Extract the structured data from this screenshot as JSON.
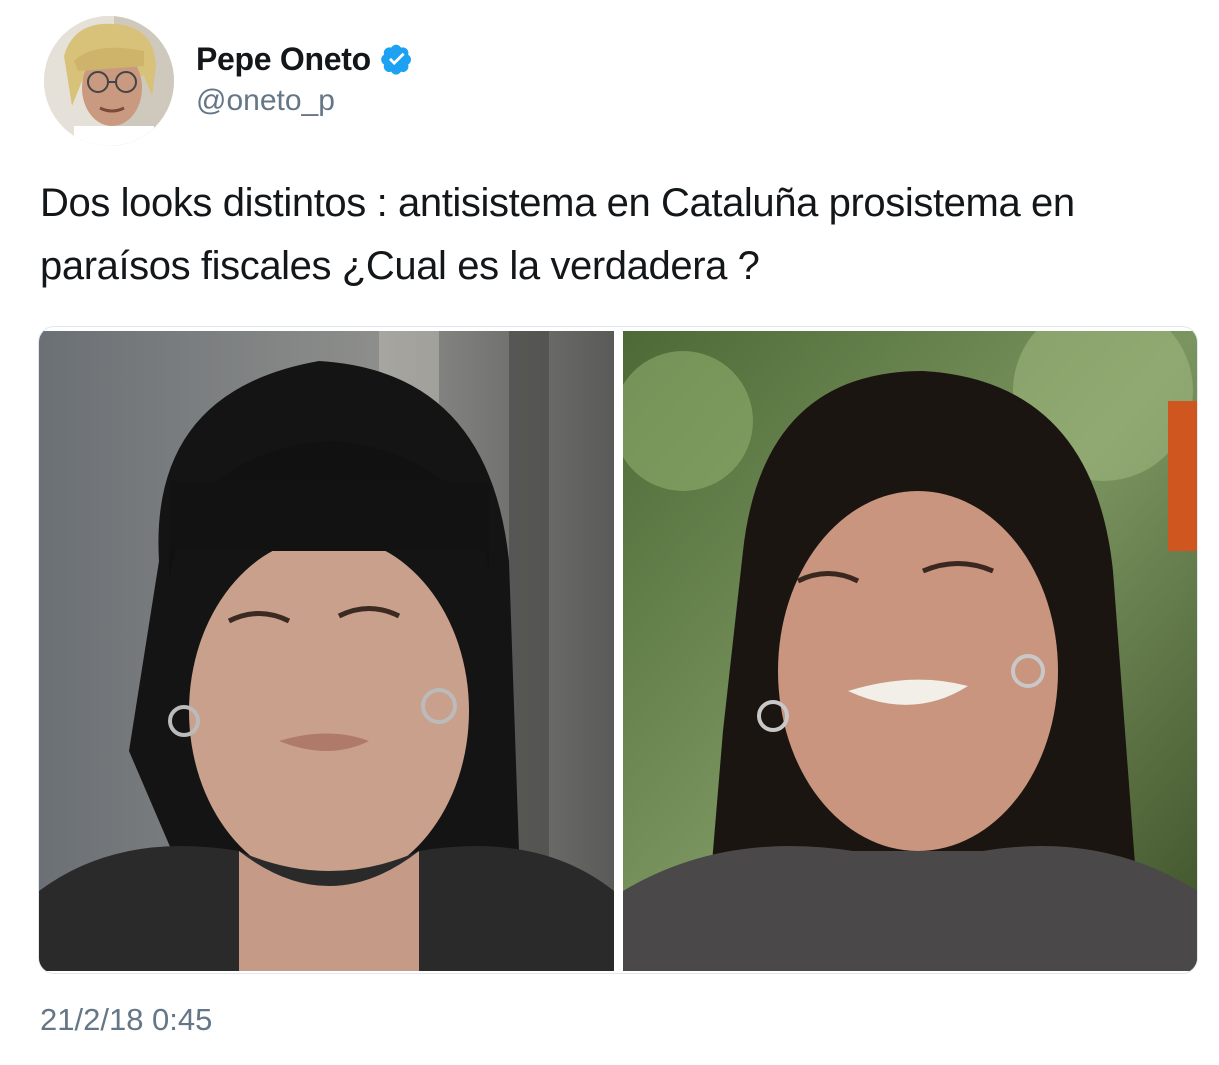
{
  "tweet": {
    "author": {
      "display_name": "Pepe Oneto",
      "handle": "@oneto_p",
      "verified": true,
      "verified_color": "#1da1f2"
    },
    "text": "Dos looks distintos : antisistema en Cataluña prosistema en paraísos fiscales ¿Cual es la verdadera ?",
    "media": {
      "count": 2
    },
    "timestamp": "21/2/18 0:45"
  },
  "icons": {
    "verified": "verified-badge-icon",
    "avatar": "avatar"
  },
  "colors": {
    "text": "#14171a",
    "secondary_text": "#657786",
    "border": "#e1e8ed"
  }
}
